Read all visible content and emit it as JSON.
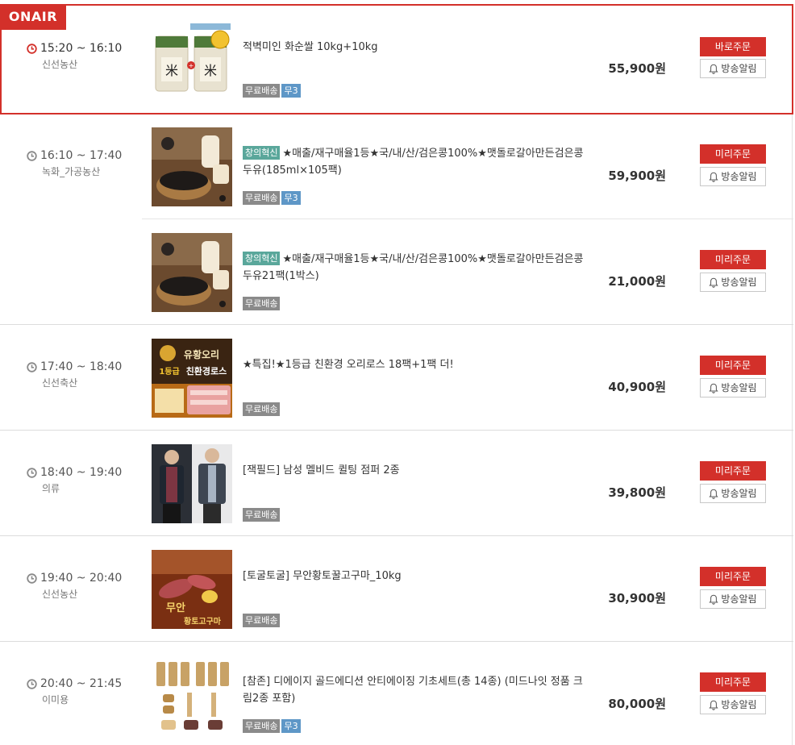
{
  "onair_label": "ONAIR",
  "colors": {
    "accent": "#d3302a",
    "promo_tag": "#5aa79b",
    "shipping_tag": "#8a8a8a",
    "badge_blue": "#5e97c7"
  },
  "slots": [
    {
      "time": "15:20 ~ 16:10",
      "category": "신선농산",
      "onair": true,
      "products": [
        {
          "image": "rice-bag-image",
          "promo": "",
          "title": "적벽미인 화순쌀 10kg+10kg",
          "tags": [
            "무료배송",
            "무3"
          ],
          "price": "55,900원",
          "order_label": "바로주문",
          "alarm_label": "방송알림"
        }
      ]
    },
    {
      "time": "16:10 ~ 17:40",
      "category": "녹화_가공농산",
      "onair": false,
      "products": [
        {
          "image": "black-bean-image",
          "promo": "창의혁신",
          "title": "★매출/재구매율1등★국/내/산/검은콩100%★맷돌로갈아만든검은콩두유(185ml×105팩)",
          "tags": [
            "무료배송",
            "무3"
          ],
          "price": "59,900원",
          "order_label": "미리주문",
          "alarm_label": "방송알림"
        },
        {
          "image": "black-bean-image",
          "promo": "창의혁신",
          "title": "★매출/재구매율1등★국/내/산/검은콩100%★맷돌로갈아만든검은콩두유21팩(1박스)",
          "tags": [
            "무료배송"
          ],
          "price": "21,000원",
          "order_label": "미리주문",
          "alarm_label": "방송알림"
        }
      ]
    },
    {
      "time": "17:40 ~ 18:40",
      "category": "신선축산",
      "onair": false,
      "products": [
        {
          "image": "duck-roast-image",
          "image_text": [
            "유황오리",
            "1등급",
            "친환경로스"
          ],
          "promo": "",
          "title": "★특집!★1등급 친환경 오리로스 18팩+1팩 더!",
          "tags": [
            "무료배송"
          ],
          "price": "40,900원",
          "order_label": "미리주문",
          "alarm_label": "방송알림"
        }
      ]
    },
    {
      "time": "18:40 ~ 19:40",
      "category": "의류",
      "onair": false,
      "products": [
        {
          "image": "men-jacket-image",
          "promo": "",
          "title": "[잭필드] 남성 멜비드 퀼팅 점퍼 2종",
          "tags": [
            "무료배송"
          ],
          "price": "39,800원",
          "order_label": "미리주문",
          "alarm_label": "방송알림"
        }
      ]
    },
    {
      "time": "19:40 ~ 20:40",
      "category": "신선농산",
      "onair": false,
      "products": [
        {
          "image": "sweet-potato-image",
          "image_text": [
            "무안",
            "황토고구마"
          ],
          "promo": "",
          "title": "[토굴토굴] 무안황토꿀고구마_10kg",
          "tags": [
            "무료배송"
          ],
          "price": "30,900원",
          "order_label": "미리주문",
          "alarm_label": "방송알림"
        }
      ]
    },
    {
      "time": "20:40 ~ 21:45",
      "category": "이미용",
      "onair": false,
      "products": [
        {
          "image": "cosmetics-set-image",
          "promo": "",
          "title": "[참존] 디에이지 골드에디션 안티에이징 기초세트(총 14종) (미드나잇 정품 크림2종 포함)",
          "tags": [
            "무료배송",
            "무3"
          ],
          "price": "80,000원",
          "order_label": "미리주문",
          "alarm_label": "방송알림"
        }
      ]
    }
  ]
}
